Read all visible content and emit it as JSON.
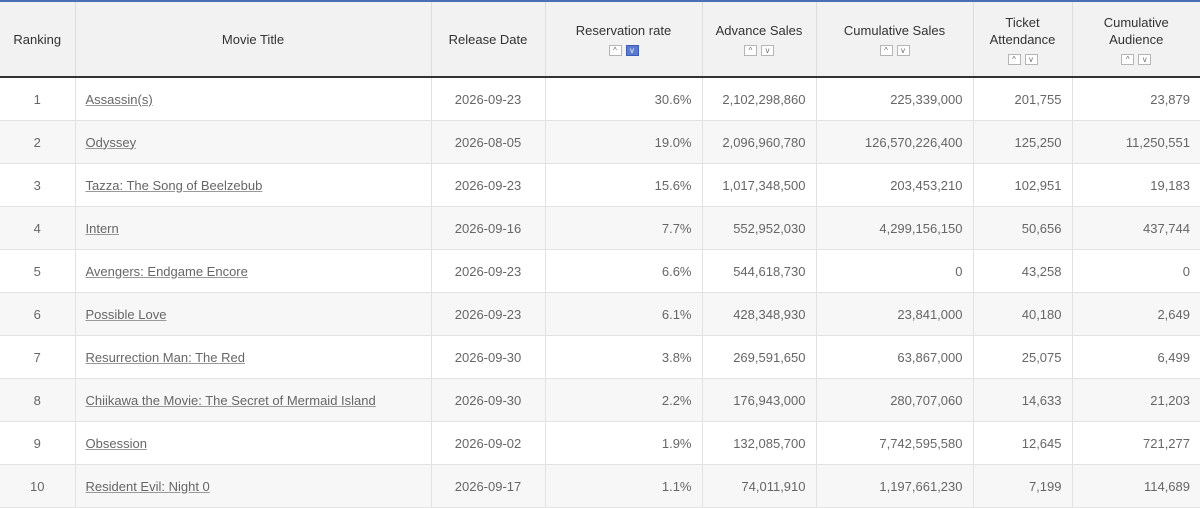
{
  "headers": {
    "ranking": "Ranking",
    "movie_title": "Movie Title",
    "release_date": "Release Date",
    "reservation_rate": "Reservation rate",
    "advance_sales": "Advance Sales",
    "cumulative_sales": "Cumulative Sales",
    "ticket_attendance_1": "Ticket",
    "ticket_attendance_2": "Attendance",
    "cumulative_audience_1": "Cumulative",
    "cumulative_audience_2": "Audience"
  },
  "sort_icons": {
    "up": "^",
    "down": "v",
    "active_column": "reservation_rate",
    "active_direction": "down"
  },
  "colors": {
    "header_bg": "#f2f2f2",
    "accent": "#5b7bd0",
    "top_bar": "#4a6fb5"
  },
  "rows": [
    {
      "rank": "1",
      "title": "Assassin(s)",
      "release": "2026-09-23",
      "rate": "30.6%",
      "advance": "2,102,298,860",
      "cum_sales": "225,339,000",
      "attendance": "201,755",
      "cum_audience": "23,879"
    },
    {
      "rank": "2",
      "title": "Odyssey",
      "release": "2026-08-05",
      "rate": "19.0%",
      "advance": "2,096,960,780",
      "cum_sales": "126,570,226,400",
      "attendance": "125,250",
      "cum_audience": "11,250,551"
    },
    {
      "rank": "3",
      "title": "Tazza: The Song of Beelzebub",
      "release": "2026-09-23",
      "rate": "15.6%",
      "advance": "1,017,348,500",
      "cum_sales": "203,453,210",
      "attendance": "102,951",
      "cum_audience": "19,183"
    },
    {
      "rank": "4",
      "title": "Intern",
      "release": "2026-09-16",
      "rate": "7.7%",
      "advance": "552,952,030",
      "cum_sales": "4,299,156,150",
      "attendance": "50,656",
      "cum_audience": "437,744"
    },
    {
      "rank": "5",
      "title": "Avengers: Endgame Encore",
      "release": "2026-09-23",
      "rate": "6.6%",
      "advance": "544,618,730",
      "cum_sales": "0",
      "attendance": "43,258",
      "cum_audience": "0"
    },
    {
      "rank": "6",
      "title": "Possible Love",
      "release": "2026-09-23",
      "rate": "6.1%",
      "advance": "428,348,930",
      "cum_sales": "23,841,000",
      "attendance": "40,180",
      "cum_audience": "2,649"
    },
    {
      "rank": "7",
      "title": "Resurrection Man: The Red",
      "release": "2026-09-30",
      "rate": "3.8%",
      "advance": "269,591,650",
      "cum_sales": "63,867,000",
      "attendance": "25,075",
      "cum_audience": "6,499"
    },
    {
      "rank": "8",
      "title": "Chiikawa the Movie: The Secret of Mermaid Island",
      "release": "2026-09-30",
      "rate": "2.2%",
      "advance": "176,943,000",
      "cum_sales": "280,707,060",
      "attendance": "14,633",
      "cum_audience": "21,203"
    },
    {
      "rank": "9",
      "title": "Obsession",
      "release": "2026-09-02",
      "rate": "1.9%",
      "advance": "132,085,700",
      "cum_sales": "7,742,595,580",
      "attendance": "12,645",
      "cum_audience": "721,277"
    },
    {
      "rank": "10",
      "title": "Resident Evil: Night 0",
      "release": "2026-09-17",
      "rate": "1.1%",
      "advance": "74,011,910",
      "cum_sales": "1,197,661,230",
      "attendance": "7,199",
      "cum_audience": "114,689"
    }
  ]
}
